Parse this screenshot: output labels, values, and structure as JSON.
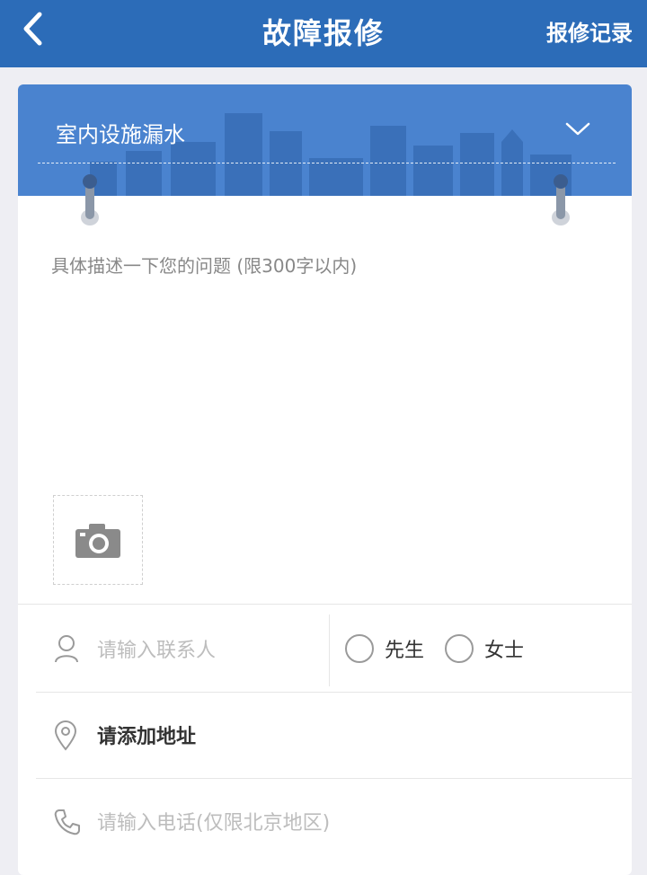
{
  "navbar": {
    "title": "故障报修",
    "right_link": "报修记录",
    "back_icon": "chevron-left-icon"
  },
  "category": {
    "selected": "室内设施漏水",
    "icon": "chevron-down-icon"
  },
  "description": {
    "placeholder": "具体描述一下您的问题 (限300字以内)"
  },
  "photo": {
    "icon": "camera-icon"
  },
  "contact": {
    "placeholder": "请输入联系人",
    "icon": "person-icon",
    "gender_options": [
      "先生",
      "女士"
    ]
  },
  "address": {
    "label": "请添加地址",
    "icon": "location-pin-icon"
  },
  "phone": {
    "placeholder": "请输入电话(仅限北京地区)",
    "icon": "phone-icon"
  },
  "colors": {
    "navbar": "#2c6cb8",
    "category_bar": "#4a83cf",
    "background": "#eeeef3"
  }
}
